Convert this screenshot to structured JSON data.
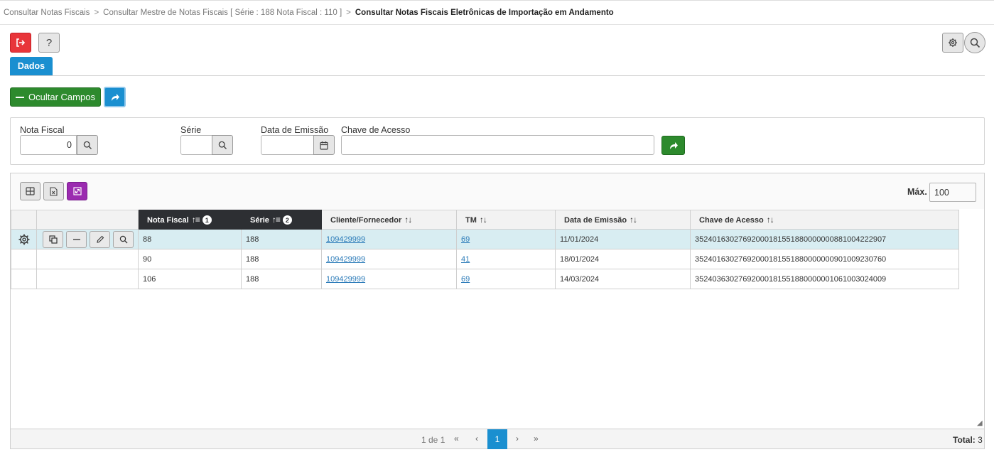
{
  "breadcrumb": {
    "item1": "Consultar Notas Fiscais",
    "item2": "Consultar Mestre de Notas Fiscais [ Série : 188 Nota Fiscal : 110 ]",
    "current": "Consultar Notas Fiscais Eletrônicas de Importação em Andamento",
    "separator": ">"
  },
  "toolbar": {
    "help_label": "?"
  },
  "tabs": {
    "dados": "Dados"
  },
  "actions": {
    "ocultar_campos": "Ocultar Campos"
  },
  "filters": {
    "nota_fiscal": {
      "label": "Nota Fiscal",
      "value": "0"
    },
    "serie": {
      "label": "Série",
      "value": ""
    },
    "data_emissao": {
      "label": "Data de Emissão",
      "value": ""
    },
    "chave_acesso": {
      "label": "Chave de Acesso",
      "value": ""
    }
  },
  "grid": {
    "max_label": "Máx.",
    "max_value": "100",
    "columns": {
      "nota_fiscal": "Nota Fiscal",
      "serie": "Série",
      "cliente": "Cliente/Fornecedor",
      "tm": "TM",
      "data_emissao": "Data de Emissão",
      "chave": "Chave de Acesso"
    },
    "sort_badges": {
      "nota_fiscal": "1",
      "serie": "2"
    },
    "rows": [
      {
        "nota_fiscal": "88",
        "serie": "188",
        "cliente": "109429999",
        "tm": "69",
        "data_emissao": "11/01/2024",
        "chave": "35240163027692000181551880000000881004222907"
      },
      {
        "nota_fiscal": "90",
        "serie": "188",
        "cliente": "109429999",
        "tm": "41",
        "data_emissao": "18/01/2024",
        "chave": "35240163027692000181551880000000901009230760"
      },
      {
        "nota_fiscal": "106",
        "serie": "188",
        "cliente": "109429999",
        "tm": "69",
        "data_emissao": "14/03/2024",
        "chave": "35240363027692000181551880000001061003024009"
      }
    ]
  },
  "pagination": {
    "info": "1 de 1",
    "first": "«",
    "prev": "‹",
    "current_page": "1",
    "next": "›",
    "last": "»",
    "total_label": "Total:",
    "total_value": "3"
  },
  "colors": {
    "primary_blue": "#1a8fd0",
    "green": "#2d8a2d",
    "red": "#e8353a",
    "purple": "#9b2bb0",
    "header_dark": "#2d2f33",
    "selected_row": "#d8edf2"
  }
}
